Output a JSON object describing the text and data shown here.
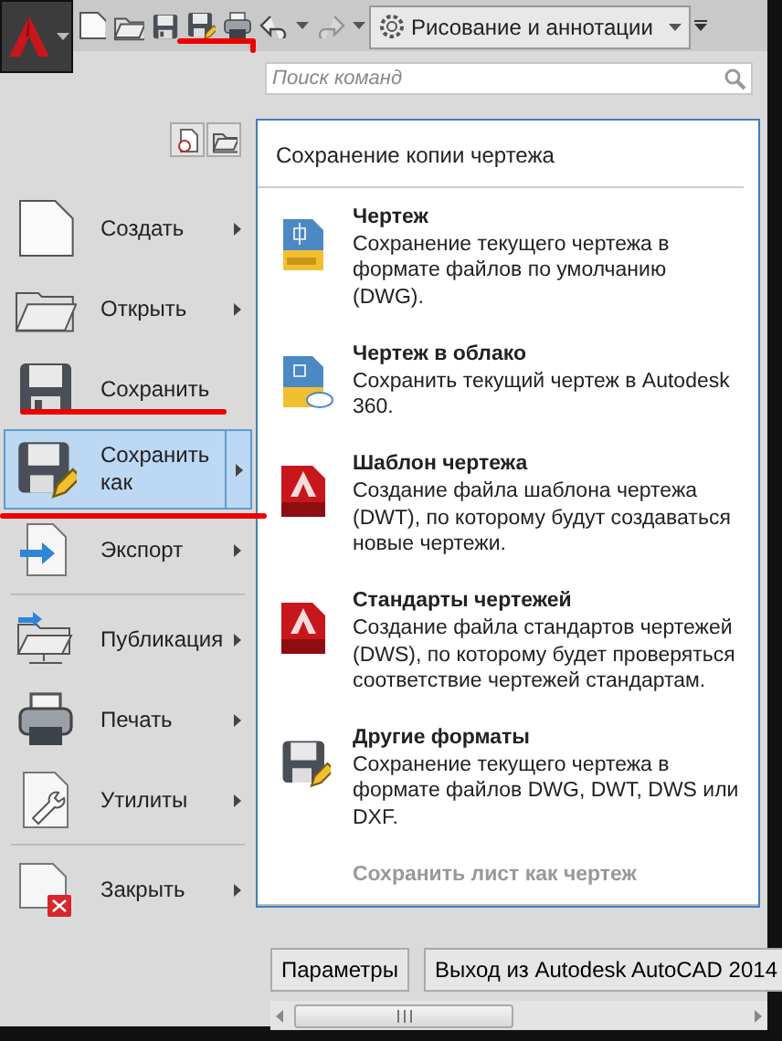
{
  "toolbar": {
    "workspace": "Рисование и аннотации",
    "redo_disabled": true
  },
  "search": {
    "placeholder": "Поиск команд"
  },
  "menu_groups": [
    [
      {
        "label": "Создать",
        "has_submenu": true,
        "selected": false
      },
      {
        "label": "Открыть",
        "has_submenu": true,
        "selected": false
      },
      {
        "label": "Сохранить",
        "has_submenu": false,
        "selected": false
      },
      {
        "label": "Сохранить как",
        "has_submenu": true,
        "selected": true
      },
      {
        "label": "Экспорт",
        "has_submenu": true,
        "selected": false
      }
    ],
    [
      {
        "label": "Публикация",
        "has_submenu": true,
        "selected": false
      },
      {
        "label": "Печать",
        "has_submenu": true,
        "selected": false
      },
      {
        "label": "Утилиты",
        "has_submenu": true,
        "selected": false
      }
    ],
    [
      {
        "label": "Закрыть",
        "has_submenu": true,
        "selected": false
      }
    ]
  ],
  "panel": {
    "title": "Сохранение копии чертежа",
    "items": [
      {
        "title": "Чертеж",
        "description": "Сохранение текущего чертежа в формате файлов по умолчанию (DWG).",
        "disabled": false
      },
      {
        "title": "Чертеж в облако",
        "description": "Сохранить текущий чертеж в Autodesk 360.",
        "disabled": false
      },
      {
        "title": "Шаблон чертежа",
        "description": "Создание файла шаблона чертежа (DWT), по которому будут создаваться новые чертежи.",
        "disabled": false
      },
      {
        "title": "Стандарты чертежей",
        "description": "Создание файла стандартов чертежей (DWS), по которому будет проверяться соответствие чертежей стандартам.",
        "disabled": false
      },
      {
        "title": "Другие форматы",
        "description": "Сохранение текущего чертежа в формате файлов DWG, DWT, DWS или DXF.",
        "disabled": false
      },
      {
        "title": "Сохранить лист как чертеж",
        "disabled": true
      }
    ]
  },
  "footer_buttons": [
    "Параметры",
    "Выход из Autodesk AutoCAD 2014"
  ]
}
